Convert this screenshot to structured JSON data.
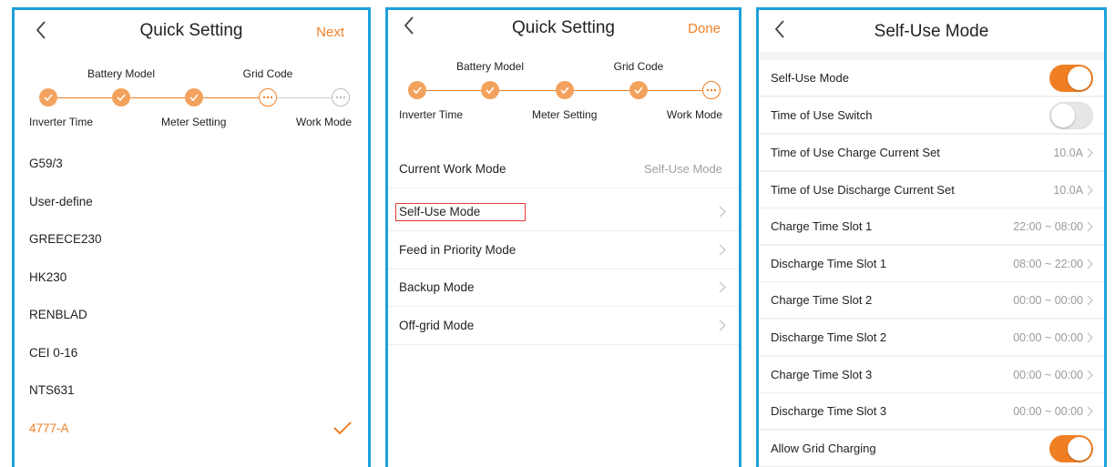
{
  "colors": {
    "accent": "#f07f24",
    "frame": "#1ea0dd",
    "highlight": "#e53935"
  },
  "panel1": {
    "title": "Quick Setting",
    "action": "Next",
    "steps": {
      "inverter_time": "Inverter Time",
      "battery_model": "Battery Model",
      "meter_setting": "Meter Setting",
      "grid_code": "Grid Code",
      "work_mode": "Work Mode"
    },
    "grid_codes": [
      "G59/3",
      "User-define",
      "GREECE230",
      "HK230",
      "RENBLAD",
      "CEI 0-16",
      "NTS631",
      "4777-A"
    ],
    "selected_grid_code": "4777-A"
  },
  "panel2": {
    "title": "Quick Setting",
    "action": "Done",
    "steps": {
      "inverter_time": "Inverter Time",
      "battery_model": "Battery Model",
      "meter_setting": "Meter Setting",
      "grid_code": "Grid Code",
      "work_mode": "Work Mode"
    },
    "current_mode_label": "Current Work Mode",
    "current_mode_value": "Self-Use Mode",
    "modes": [
      "Self-Use Mode",
      "Feed in Priority Mode",
      "Backup Mode",
      "Off-grid Mode"
    ]
  },
  "panel3": {
    "title": "Self-Use Mode",
    "self_use_label": "Self-Use Mode",
    "tou_switch_label": "Time of Use Switch",
    "tou_charge_label": "Time of Use Charge Current Set",
    "tou_charge_value": "10.0A",
    "tou_discharge_label": "Time of Use Discharge Current Set",
    "tou_discharge_value": "10.0A",
    "slots": [
      {
        "label": "Charge Time Slot 1",
        "value": "22:00 ~ 08:00"
      },
      {
        "label": "Discharge Time Slot 1",
        "value": "08:00 ~ 22:00"
      },
      {
        "label": "Charge Time Slot 2",
        "value": "00:00 ~ 00:00"
      },
      {
        "label": "Discharge Time Slot 2",
        "value": "00:00 ~ 00:00"
      },
      {
        "label": "Charge Time Slot 3",
        "value": "00:00 ~ 00:00"
      },
      {
        "label": "Discharge Time Slot 3",
        "value": "00:00 ~ 00:00"
      }
    ],
    "allow_grid_label": "Allow Grid Charging",
    "toggles": {
      "self_use": true,
      "tou_switch": false,
      "allow_grid": true
    }
  }
}
